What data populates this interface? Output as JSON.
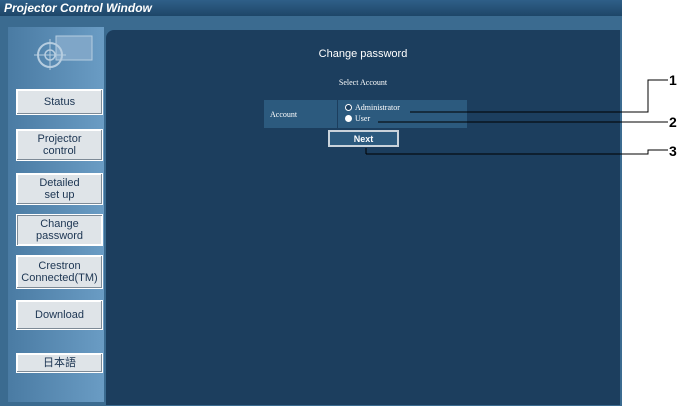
{
  "window": {
    "title": "Projector Control Window"
  },
  "sidebar": {
    "items": [
      {
        "label": "Status"
      },
      {
        "label": "Projector\ncontrol"
      },
      {
        "label": "Detailed\nset up"
      },
      {
        "label": "Change\npassword"
      },
      {
        "label": "Crestron\nConnected(TM)"
      },
      {
        "label": "Download"
      },
      {
        "label": "日本語"
      }
    ]
  },
  "main": {
    "heading": "Change password",
    "subheading": "Select Account",
    "account_label": "Account",
    "options": [
      {
        "label": "Administrator",
        "selected": true
      },
      {
        "label": "User",
        "selected": false
      }
    ],
    "next_label": "Next"
  },
  "callouts": [
    "1",
    "2",
    "3"
  ]
}
